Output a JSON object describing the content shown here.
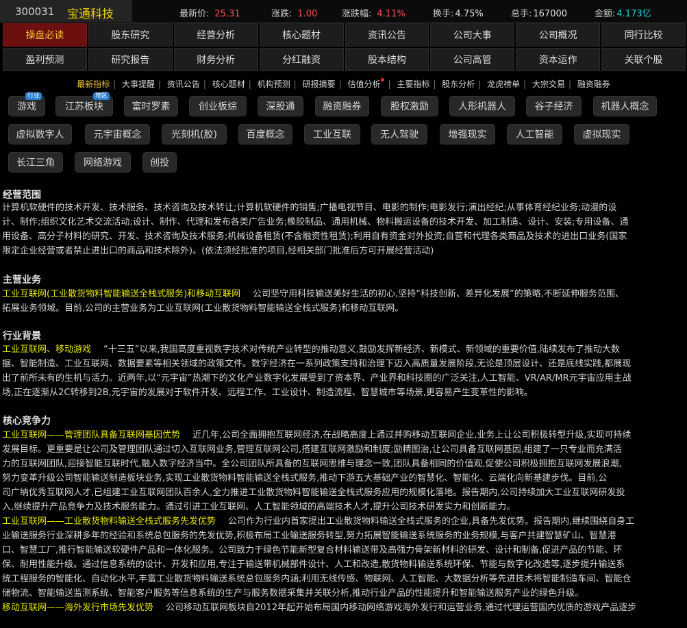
{
  "header": {
    "code": "300031",
    "name": "宝通科技",
    "quotes": [
      {
        "label": "最新价:",
        "value": "25.31",
        "color": "red"
      },
      {
        "label": "涨跌:",
        "value": "1.00",
        "color": "red"
      },
      {
        "label": "涨跌幅:",
        "value": "4.11%",
        "color": "red"
      },
      {
        "label": "换手:",
        "value": "4.75%",
        "color": "white"
      },
      {
        "label": "总手:",
        "value": "167000",
        "color": "white"
      },
      {
        "label": "金额:",
        "value": "4.173亿",
        "color": "cyan"
      }
    ]
  },
  "nav_row1": [
    "操盘必读",
    "股东研究",
    "经营分析",
    "核心题材",
    "资讯公告",
    "公司大事",
    "公司概况",
    "同行比较"
  ],
  "nav_row2": [
    "盈利预测",
    "研究报告",
    "财务分析",
    "分红融资",
    "股本结构",
    "公司高管",
    "资本运作",
    "关联个股"
  ],
  "subnav": [
    "最新指标",
    "大事提醒",
    "资讯公告",
    "核心题材",
    "机构预测",
    "研报摘要",
    "估值分析",
    "主要指标",
    "股东分析",
    "龙虎榜单",
    "大宗交易",
    "融资融券"
  ],
  "tags": [
    {
      "label": "游戏",
      "badge": "行业"
    },
    {
      "label": "江苏板块",
      "badge": "地区"
    },
    {
      "label": "富时罗素"
    },
    {
      "label": "创业板综"
    },
    {
      "label": "深股通"
    },
    {
      "label": "融资融券"
    },
    {
      "label": "股权激励"
    },
    {
      "label": "人形机器人"
    },
    {
      "label": "谷子经济"
    },
    {
      "label": "机器人概念"
    },
    {
      "label": "虚拟数字人"
    },
    {
      "label": "元宇宙概念"
    },
    {
      "label": "光刻机(胶)"
    },
    {
      "label": "百度概念"
    },
    {
      "label": "工业互联"
    },
    {
      "label": "无人驾驶"
    },
    {
      "label": "增强现实"
    },
    {
      "label": "人工智能"
    },
    {
      "label": "虚拟现实"
    },
    {
      "label": "长江三角"
    },
    {
      "label": "网络游戏"
    },
    {
      "label": "创投"
    }
  ],
  "sections": {
    "scope": {
      "title": "经营范围",
      "lines": [
        "计算机软硬件的技术开发、技术服务、技术咨询及技术转让;计算机软硬件的销售;广播电视节目、电影的制作;电影发行;演出经纪;从事体育经纪业务;动漫的设",
        "计、制作;组织文化艺术交流活动;设计、制作、代理和发布各类广告业务;橡胶制品、通用机械、物料搬运设备的技术开发、加工制造、设计、安装;专用设备、通",
        "用设备、高分子材料的研究、开发、技术咨询及技术服务;机械设备租赁(不含融资性租赁);利用自有资金对外投资;自营和代理各类商品及技术的进出口业务(国家",
        "限定企业经营或者禁止进出口的商品和技术除外)。(依法须经批准的项目,经相关部门批准后方可开展经营活动)"
      ]
    },
    "main": {
      "title": "主营业务",
      "head": "工业互联网(工业散货物料智能输送全栈式服务)和移动互联网",
      "text": "公司坚守用科技输送美好生活的初心,坚持“科技创新、差异化发展”的策略,不断延伸服务范围、",
      "lines": [
        "拓展业务领域。目前,公司的主营业务为工业互联网(工业散货物料智能输送全栈式服务)和移动互联网。"
      ]
    },
    "industry": {
      "title": "行业背景",
      "head": "工业互联网、移动游戏",
      "text": "“十三五”以来,我国高度重视数字技术对传统产业转型的推动意义,鼓励发挥新经济、新模式、新领域的重要价值,陆续发布了推动大数",
      "lines": [
        "据、智能制造、工业互联网、数据要素等相关领域的政策文件。数字经济在一系列政策支持和治理下迈入高质量发展阶段,无论是顶层设计、还是底线实践,都展现",
        "出了前所未有的生机与活力。近两年,以“元宇宙”热潮下的文化产业数字化发展受到了资本界、产业界和科技圈的广泛关注,人工智能、VR/AR/MR元宇宙应用主战",
        "场,正在逐渐从2C转移到2B,元宇宙的发展对于软件开发、远程工作、工业设计、制造流程、智慧城市等场景,更容易产生变革性的影响。"
      ]
    },
    "core": {
      "title": "核心竞争力",
      "p1_head": "工业互联网——管理团队具备互联网基因优势",
      "p1_text": "近几年,公司全面拥抱互联网经济,在战略高度上通过并购移动互联网企业,业务上让公司积极转型升级,实现可持续",
      "p1_lines": [
        "发展目标。更重要是让公司及管理团队通过切入互联网业务,管理互联网公司,搭建互联网激励和制度;励精图治,让公司具备互联网基因,组建了一只专业而充满活",
        "力的互联网团队,迎接智能互联时代,融入数字经济当中。全公司团队所具备的互联网思维与理念一致,团队具备相同的价值观,促使公司积极拥抱互联网发展浪潮,",
        "努力变革升级公司智能输送制造板块业务,实现工业散货物料智能输送全栈式服务,推动下游五大基础产业的智慧化、智能化、云端化向新基建步伐。目前,公",
        "司广纳优秀互联网人才,已组建工业互联网团队百余人,全力推进工业散货物料智能输送全栈式服务应用的规模化落地。报告期内,公司持续加大工业互联网研发投",
        "入,继续提升产品竞争力及技术服务能力。通过引进工业互联网、人工智能领域的高端技术人才,提升公司技术研发实力和创新能力。"
      ],
      "p2_head": "工业互联网——工业散货物料输送全栈式服务先发优势",
      "p2_text": "公司作为行业内首家提出工业散货物料输送全栈式服务的企业,具备先发优势。报告期内,继续围绕自身工",
      "p2_lines": [
        "业输送服务行业深耕多年的经验和系统总包服务的先发优势,积极布局工业输送服务转型,努力拓展智能输送系统服务的业务规模,与客户共建智慧矿山、智慧港",
        "口、智慧工厂,推行智能输送软硬件产品和一体化服务。公司致力于绿色节能新型复合材料输送带及高强力骨架新材料的研发、设计和制备,促进产品的节能、环",
        "保、耐用性能升级。通过信息系统的设计、开发和应用,专注于输送带机械部件设计、人工和改造,散货物料输送系统环保、节能与数字化改造等,逐步提升输送系",
        "统工程服务的智能化、自动化水平,丰富工业散货物料输送系统总包服务内涵;利用无线传感、物联网、人工智能、大数据分析等先进技术将智能制造车间、智能仓",
        "储物流、智能输送监测系统、智能客户服务等信息系统的生产与服务数据采集并关联分析,推动行业产品的性能提升和智能输送服务产业的绿色升级。"
      ],
      "p3_head": "移动互联网——海外发行市场先发优势",
      "p3_text": "公司移动互联网板块自2012年起开始布局国内移动网络游戏海外发行和运营业务,通过代理运营国内优质的游戏产品逐步"
    }
  }
}
